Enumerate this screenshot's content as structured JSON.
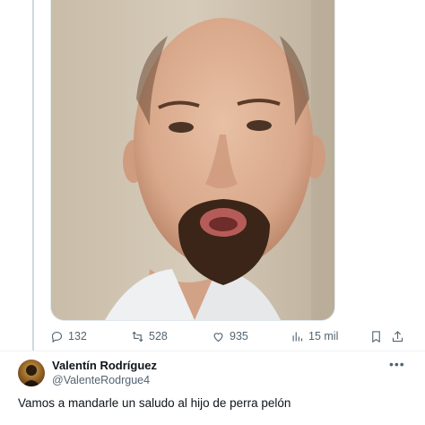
{
  "tweet": {
    "stats": {
      "replies": "132",
      "retweets": "528",
      "likes": "935",
      "views": "15 mil"
    }
  },
  "reply": {
    "author_name": "Valentín Rodríguez",
    "author_handle": "@ValenteRodrgue4",
    "text": "Vamos a mandarle un saludo al hijo de perra pelón"
  },
  "icons": [
    "reply-icon",
    "retweet-icon",
    "like-icon",
    "views-icon",
    "bookmark-icon",
    "share-icon",
    "more-icon"
  ]
}
